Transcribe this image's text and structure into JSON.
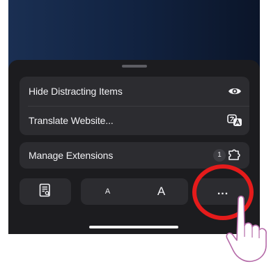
{
  "menu": {
    "hide_distracting_items": "Hide Distracting Items",
    "translate_website": "Translate Website...",
    "manage_extensions": "Manage Extensions",
    "extensions_count": "1"
  },
  "toolbar": {
    "text_size_small": "A",
    "text_size_large": "A",
    "more_label": "..."
  },
  "icons": {
    "hide_items": "eye-icon",
    "translate": "translate-icon",
    "extensions": "puzzle-icon",
    "reader": "reader-icon",
    "more": "ellipsis-icon"
  },
  "colors": {
    "sheet": "#1c1c1f",
    "row": "#2c2c30",
    "highlight_ring": "#e51b1b"
  }
}
